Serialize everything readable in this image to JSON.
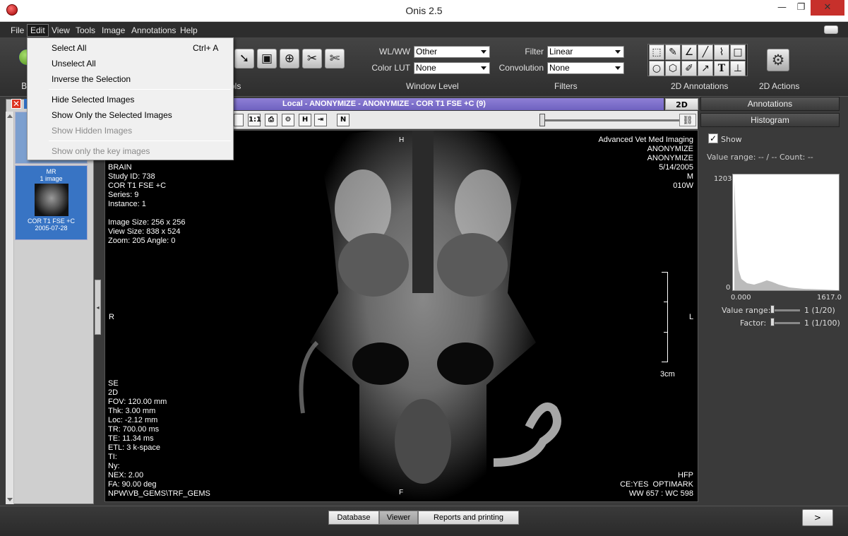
{
  "window": {
    "title": "Onis 2.5",
    "min": "—",
    "max": "❐",
    "close": "✕"
  },
  "menubar": {
    "items": [
      "File",
      "Edit",
      "View",
      "Tools",
      "Image",
      "Annotations",
      "Help"
    ]
  },
  "edit_menu": {
    "items": [
      {
        "label": "Select All",
        "shortcut": "Ctrl+ A",
        "enabled": true
      },
      {
        "label": "Unselect All",
        "enabled": true
      },
      {
        "label": "Inverse the Selection",
        "enabled": true
      },
      {
        "label": "Hide Selected Images",
        "enabled": true
      },
      {
        "label": "Show Only the Selected Images",
        "enabled": true
      },
      {
        "label": "Show Hidden Images",
        "enabled": false
      },
      {
        "label": "Show only the key images",
        "enabled": false
      }
    ]
  },
  "toolbar": {
    "back_label": "Ba",
    "tools_label": "ols",
    "wlww_label": "WL/WW",
    "wlww_value": "Other",
    "colorlut_label": "Color LUT",
    "colorlut_value": "None",
    "filter_label": "Filter",
    "filter_value": "Linear",
    "convolution_label": "Convolution",
    "convolution_value": "None",
    "window_level_label": "Window Level",
    "filters_label": "Filters",
    "annotations_label": "2D Annotations",
    "actions_label": "2D Actions"
  },
  "left_panel": {
    "thumb2": {
      "modality": "MR",
      "count": "1 image",
      "series": "COR T1 FSE +C",
      "date": "2005-07-28"
    }
  },
  "viewer": {
    "header": "Local - ANONYMIZE - ANONYMIZE - COR T1 FSE +C (9)",
    "tab_2d": "2D",
    "vt_buttons": {
      "one_to_one": "1:1"
    },
    "overlay_top_left": "BRAIN\nStudy ID: 738\nCOR T1 FSE +C\nSeries: 9\nInstance: 1\n\nImage Size: 256 x 256\nView Size: 838 x 524\nZoom: 205 Angle: 0",
    "overlay_top_right": "Advanced Vet Med Imaging\nANONYMIZE\nANONYMIZE\n5/14/2005\nM\n010W",
    "overlay_bottom_left": "SE\n2D\nFOV: 120.00 mm\nThk: 3.00 mm\nLoc: -2.12 mm\nTR: 700.00 ms\nTE: 11.34 ms\nETL: 3 k-space\nTI:\nNy:\nNEX: 2.00\nFA: 90.00 deg\nNPW\\VB_GEMS\\TRF_GEMS",
    "overlay_bottom_right": "HFP\nCE:YES  OPTIMARK\nWW 657 : WC 598",
    "orient_top": "H",
    "orient_bottom": "F",
    "orient_left": "R",
    "orient_right": "L",
    "scale_label": "3cm"
  },
  "right_panel": {
    "annotations_tab": "Annotations",
    "histogram_tab": "Histogram",
    "show_label": "Show",
    "show_checked": "✓",
    "value_range_text": "Value range: -- / --    Count: --",
    "hist_ymax": "1203",
    "hist_ymin": "0",
    "hist_xmin": "0.000",
    "hist_xmax": "1617.0",
    "value_range_label": "Value range:",
    "value_range_value": "1 (1/20)",
    "factor_label": "Factor:",
    "factor_value": "1 (1/100)"
  },
  "bottom": {
    "tabs": [
      "Database",
      "Viewer",
      "Reports and printing"
    ],
    "active": "Viewer",
    "next": ">"
  }
}
